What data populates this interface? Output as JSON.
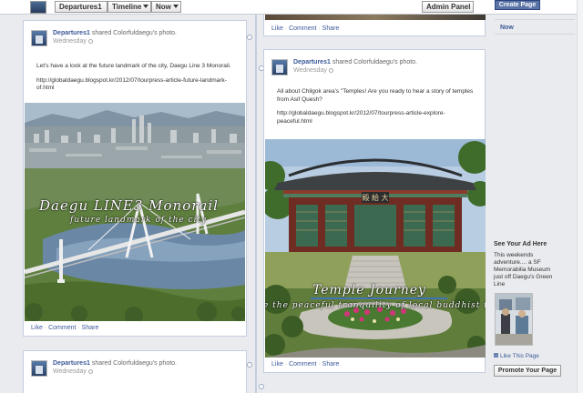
{
  "topbar": {
    "departures_label": "Departures1",
    "timeline_label": "Timeline",
    "now_label": "Now",
    "admin_label": "Admin Panel",
    "create_page_label": "Create Page"
  },
  "post_top": {
    "actions": {
      "like": "Like",
      "comment": "Comment",
      "share": "Share"
    }
  },
  "post_a": {
    "author": "Departures1",
    "shared_text": "shared Colorfuldaegu's photo.",
    "time": "Wednesday",
    "message": "Let's have a look at the future landmark of the city, Daegu Line 3 Monorail.",
    "link": "http://globaldaegu.blogspot.kr/2012/07/tourpress-article-future-landmark-of.html",
    "photo_title": "Daegu LINE3 Monorail",
    "photo_subtitle": "future landmark of the city",
    "actions": {
      "like": "Like",
      "comment": "Comment",
      "share": "Share"
    }
  },
  "post_b": {
    "author": "Departures1",
    "shared_text": "shared Colorfuldaegu's photo.",
    "time": "Wednesday",
    "message": "All about Chilgok area's \"Temples! Are you ready to hear a story of temples from Asif Quesh?",
    "link": "http://globaldaegu.blogspot.kr/2012/07/tourpress-article-explore-peaceful.html",
    "photo_title": "Temple Journey",
    "photo_subtitle": "e the peaceful tranquility of local buddhist te",
    "sign_text": "殿 給 大",
    "actions": {
      "like": "Like",
      "comment": "Comment",
      "share": "Share"
    }
  },
  "post_c": {
    "author": "Departures1",
    "shared_text": "shared Colorfuldaegu's photo.",
    "time": "Wednesday"
  },
  "sidebar": {
    "now_label": "Now",
    "ad_title": "See Your Ad Here",
    "ad_text": "This weekends adventure.... a SF Memorabilia Museum just off Daegu's Green Line",
    "like_label": "Like This Page",
    "promote_label": "Promote Your Page"
  }
}
